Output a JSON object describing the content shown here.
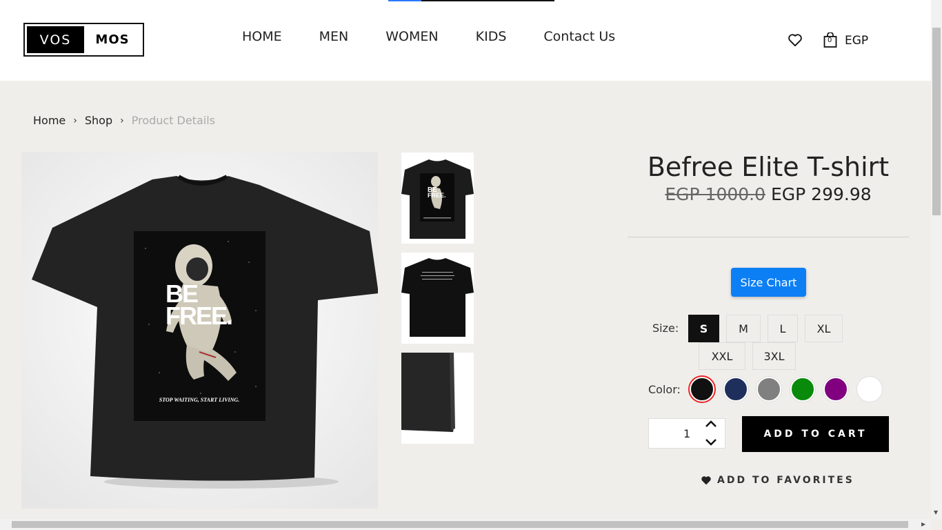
{
  "header": {
    "logo_left": "VOS",
    "logo_right": "MOS",
    "nav": [
      "HOME",
      "MEN",
      "WOMEN",
      "KIDS",
      "Contact Us"
    ],
    "cart_count": "0",
    "currency": "EGP"
  },
  "breadcrumb": {
    "home": "Home",
    "shop": "Shop",
    "current": "Product Details"
  },
  "product": {
    "title": "Befree Elite T-shirt",
    "old_price": "EGP 1000.0",
    "new_price": "EGP 299.98",
    "size_chart_label": "Size Chart",
    "size_label": "Size:",
    "sizes": [
      "S",
      "M",
      "L",
      "XL",
      "XXL",
      "3XL"
    ],
    "selected_size": "S",
    "color_label": "Color:",
    "colors": [
      "#111111",
      "#1f2f5c",
      "#808080",
      "#0a8a0a",
      "#800080",
      "#ffffff"
    ],
    "selected_color": "#111111",
    "quantity": "1",
    "add_to_cart": "ADD TO CART",
    "add_to_favorites": "ADD TO FAVORITES",
    "image_print": {
      "be": "BE",
      "free": "FREE.",
      "tagline": "STOP WAITING, START LIVING."
    }
  }
}
